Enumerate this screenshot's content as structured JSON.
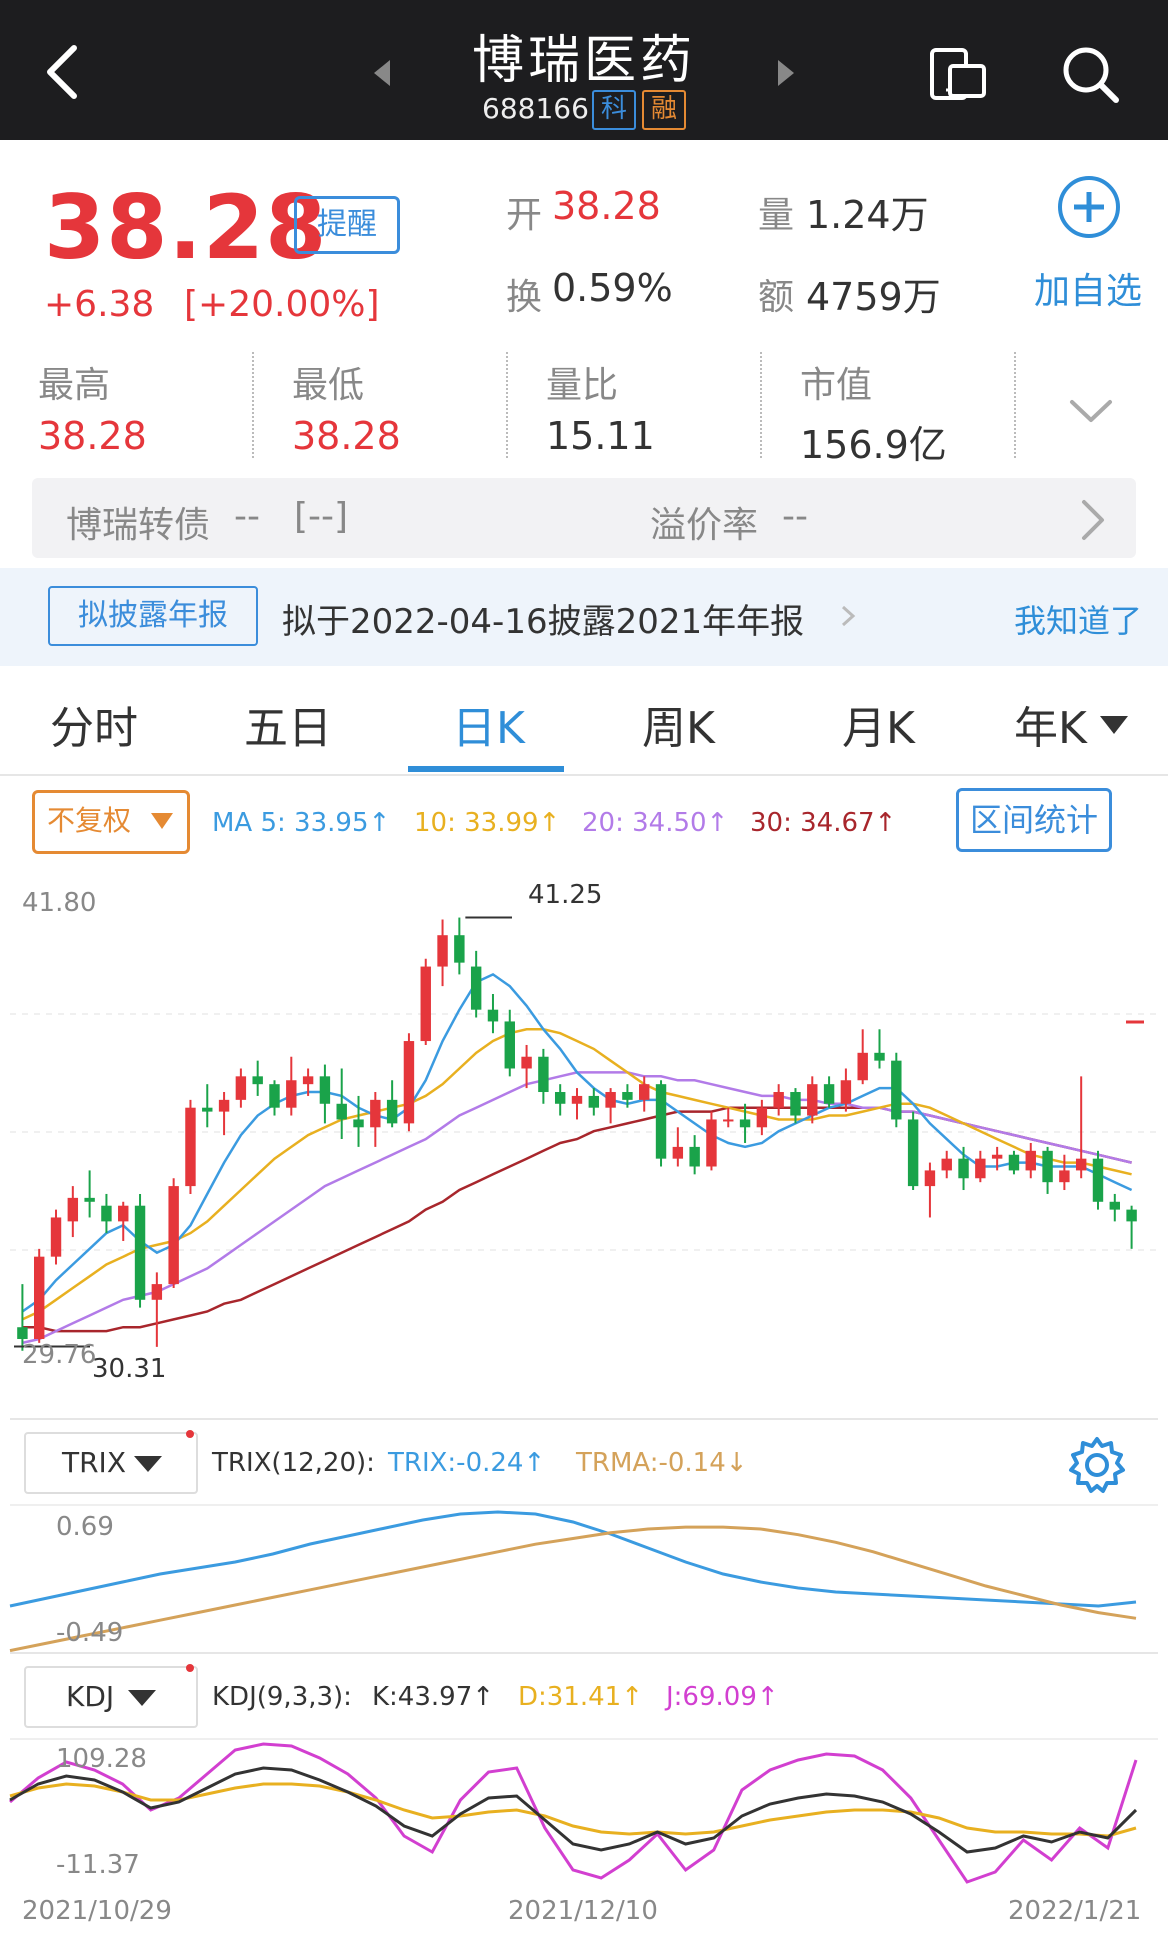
{
  "header": {
    "title": "博瑞医药",
    "code": "688166",
    "badge_ke": "科",
    "badge_rong": "融"
  },
  "quote": {
    "price": "38.28",
    "change": "+6.38",
    "change_pct": "[+20.00%]",
    "remind": "提醒",
    "open_label": "开",
    "open": "38.28",
    "volume_label": "量",
    "volume": "1.24万",
    "turnover_label": "换",
    "turnover": "0.59%",
    "amount_label": "额",
    "amount": "4759万",
    "add_watch": "加自选",
    "high_label": "最高",
    "high": "38.28",
    "low_label": "最低",
    "low": "38.28",
    "ratio_label": "量比",
    "ratio": "15.11",
    "mcap_label": "市值",
    "mcap": "156.9亿"
  },
  "bond": {
    "name": "博瑞转债",
    "value": "--",
    "pct": "[--]",
    "premium_label": "溢价率",
    "premium": "--"
  },
  "notice": {
    "tag": "拟披露年报",
    "text": "拟于2022-04-16披露2021年年报",
    "dismiss": "我知道了"
  },
  "tabs": [
    "分时",
    "五日",
    "日K",
    "周K",
    "月K",
    "年K"
  ],
  "active_tab": 2,
  "ma": {
    "adjust": "不复权",
    "ma5": "MA 5: 33.95↑",
    "ma10": "10: 33.99↑",
    "ma20": "20: 34.50↑",
    "ma30": "30: 34.67↑",
    "range_stat": "区间统计",
    "y_top": "41.80",
    "y_bottom": "29.76",
    "peak_label": "41.25",
    "low_label": "30.31"
  },
  "trix": {
    "selector": "TRIX",
    "params": "TRIX(12,20):",
    "trix": "TRIX:-0.24↑",
    "trma": "TRMA:-0.14↓",
    "y_top": "0.69",
    "y_bottom": "-0.49"
  },
  "kdj": {
    "selector": "KDJ",
    "params": "KDJ(9,3,3):",
    "k": "K:43.97↑",
    "d": "D:31.41↑",
    "j": "J:69.09↑",
    "y_top": "109.28",
    "y_bottom": "-11.37"
  },
  "dates": [
    "2021/10/29",
    "2021/12/10",
    "2022/1/21"
  ],
  "colors": {
    "up": "#e5363b",
    "down": "#1aa34a",
    "ma5": "#3b9be0",
    "ma10": "#e8b020",
    "ma20": "#b27be8",
    "ma30": "#a8262c",
    "accent": "#2f8ed8"
  },
  "chart_data": {
    "type": "candlestick",
    "ylim": [
      29.76,
      41.8
    ],
    "candles": [
      [
        30.8,
        31.9,
        30.2,
        30.5
      ],
      [
        30.5,
        32.8,
        30.4,
        32.6
      ],
      [
        32.6,
        33.8,
        32.4,
        33.6
      ],
      [
        33.5,
        34.4,
        33.1,
        34.1
      ],
      [
        34.1,
        34.8,
        33.6,
        34.0
      ],
      [
        33.9,
        34.2,
        33.2,
        33.5
      ],
      [
        33.5,
        34.0,
        33.0,
        33.9
      ],
      [
        33.9,
        34.2,
        31.3,
        31.5
      ],
      [
        31.5,
        32.2,
        30.3,
        31.9
      ],
      [
        31.9,
        34.6,
        31.8,
        34.4
      ],
      [
        34.4,
        36.6,
        34.2,
        36.4
      ],
      [
        36.4,
        37.0,
        35.9,
        36.3
      ],
      [
        36.3,
        36.8,
        35.7,
        36.6
      ],
      [
        36.6,
        37.4,
        36.4,
        37.2
      ],
      [
        37.2,
        37.6,
        36.7,
        37.0
      ],
      [
        37.0,
        37.1,
        36.2,
        36.4
      ],
      [
        36.4,
        37.7,
        36.2,
        37.1
      ],
      [
        37.0,
        37.4,
        36.7,
        37.2
      ],
      [
        37.2,
        37.5,
        36.0,
        36.5
      ],
      [
        36.5,
        37.4,
        35.6,
        36.1
      ],
      [
        36.1,
        36.7,
        35.4,
        35.9
      ],
      [
        35.9,
        36.8,
        35.4,
        36.6
      ],
      [
        36.6,
        37.1,
        35.9,
        36.0
      ],
      [
        36.0,
        38.3,
        35.8,
        38.1
      ],
      [
        38.1,
        40.2,
        38.0,
        40.0
      ],
      [
        40.0,
        41.2,
        39.5,
        40.8
      ],
      [
        40.8,
        41.25,
        39.8,
        40.1
      ],
      [
        40.0,
        40.4,
        38.7,
        38.9
      ],
      [
        38.9,
        39.3,
        38.3,
        38.6
      ],
      [
        38.6,
        38.9,
        37.2,
        37.4
      ],
      [
        37.4,
        38.0,
        36.9,
        37.7
      ],
      [
        37.7,
        37.9,
        36.5,
        36.8
      ],
      [
        36.8,
        37.0,
        36.2,
        36.5
      ],
      [
        36.5,
        36.9,
        36.1,
        36.7
      ],
      [
        36.7,
        36.9,
        36.2,
        36.4
      ],
      [
        36.4,
        36.9,
        36.0,
        36.8
      ],
      [
        36.8,
        37.0,
        36.4,
        36.6
      ],
      [
        36.6,
        37.2,
        36.3,
        37.0
      ],
      [
        37.0,
        37.1,
        34.9,
        35.1
      ],
      [
        35.1,
        35.9,
        34.9,
        35.4
      ],
      [
        35.4,
        35.7,
        34.7,
        34.9
      ],
      [
        34.9,
        36.3,
        34.8,
        36.1
      ],
      [
        36.1,
        36.4,
        35.9,
        36.1
      ],
      [
        36.1,
        36.5,
        35.5,
        35.9
      ],
      [
        35.9,
        36.6,
        35.7,
        36.4
      ],
      [
        36.4,
        37.0,
        36.2,
        36.8
      ],
      [
        36.8,
        36.9,
        36.0,
        36.2
      ],
      [
        36.2,
        37.2,
        36.0,
        37.0
      ],
      [
        37.0,
        37.2,
        36.4,
        36.5
      ],
      [
        36.5,
        37.4,
        36.3,
        37.1
      ],
      [
        37.1,
        38.4,
        37.0,
        37.8
      ],
      [
        37.8,
        38.4,
        37.4,
        37.6
      ],
      [
        37.6,
        37.8,
        35.9,
        36.1
      ],
      [
        36.1,
        36.3,
        34.3,
        34.4
      ],
      [
        34.4,
        35.0,
        33.6,
        34.8
      ],
      [
        34.8,
        35.3,
        34.6,
        35.1
      ],
      [
        35.1,
        35.4,
        34.3,
        34.6
      ],
      [
        34.6,
        35.3,
        34.5,
        35.1
      ],
      [
        35.1,
        35.4,
        34.8,
        35.2
      ],
      [
        35.2,
        35.3,
        34.7,
        34.8
      ],
      [
        34.8,
        35.5,
        34.6,
        35.3
      ],
      [
        35.3,
        35.4,
        34.2,
        34.5
      ],
      [
        34.5,
        35.2,
        34.3,
        34.8
      ],
      [
        34.8,
        37.2,
        34.6,
        35.1
      ],
      [
        35.1,
        35.3,
        33.8,
        34.0
      ],
      [
        34.0,
        34.2,
        33.5,
        33.8
      ],
      [
        33.8,
        33.9,
        32.8,
        33.5
      ]
    ],
    "ma5": [
      31.2,
      31.5,
      32.0,
      32.4,
      32.8,
      33.2,
      33.4,
      33.0,
      32.7,
      32.9,
      33.4,
      34.2,
      35.0,
      35.7,
      36.2,
      36.5,
      36.7,
      36.8,
      36.8,
      36.7,
      36.4,
      36.2,
      36.1,
      36.4,
      37.1,
      38.1,
      38.9,
      39.6,
      39.8,
      39.5,
      39.0,
      38.4,
      37.9,
      37.3,
      36.9,
      36.6,
      36.5,
      36.6,
      36.6,
      36.3,
      36.0,
      35.7,
      35.5,
      35.4,
      35.5,
      35.8,
      36.0,
      36.2,
      36.4,
      36.5,
      36.7,
      36.9,
      36.9,
      36.5,
      36.0,
      35.6,
      35.2,
      34.9,
      34.9,
      35.0,
      35.0,
      34.9,
      34.9,
      34.9,
      34.7,
      34.5,
      34.3
    ],
    "ma10": [
      31.0,
      31.2,
      31.5,
      31.8,
      32.1,
      32.4,
      32.6,
      32.8,
      32.9,
      33.0,
      33.2,
      33.5,
      33.9,
      34.3,
      34.7,
      35.1,
      35.4,
      35.7,
      35.9,
      36.1,
      36.2,
      36.3,
      36.4,
      36.5,
      36.7,
      37.0,
      37.4,
      37.8,
      38.1,
      38.3,
      38.4,
      38.4,
      38.3,
      38.1,
      37.9,
      37.6,
      37.3,
      37.0,
      36.8,
      36.7,
      36.6,
      36.5,
      36.4,
      36.3,
      36.2,
      36.1,
      36.1,
      36.1,
      36.2,
      36.2,
      36.3,
      36.4,
      36.5,
      36.5,
      36.4,
      36.2,
      36.0,
      35.8,
      35.6,
      35.4,
      35.2,
      35.1,
      35.0,
      35.0,
      34.9,
      34.8,
      34.7
    ],
    "ma20": [
      30.4,
      30.5,
      30.7,
      30.9,
      31.1,
      31.3,
      31.5,
      31.6,
      31.7,
      31.9,
      32.1,
      32.3,
      32.6,
      32.9,
      33.2,
      33.5,
      33.8,
      34.1,
      34.4,
      34.6,
      34.8,
      35.0,
      35.2,
      35.4,
      35.6,
      35.9,
      36.2,
      36.4,
      36.6,
      36.8,
      37.0,
      37.1,
      37.2,
      37.3,
      37.3,
      37.3,
      37.3,
      37.2,
      37.2,
      37.1,
      37.1,
      37.0,
      36.9,
      36.8,
      36.7,
      36.7,
      36.6,
      36.6,
      36.5,
      36.5,
      36.4,
      36.4,
      36.3,
      36.3,
      36.2,
      36.1,
      36.0,
      35.9,
      35.8,
      35.7,
      35.6,
      35.5,
      35.4,
      35.3,
      35.2,
      35.1,
      35.0
    ],
    "ma30": [
      30.8,
      30.8,
      30.7,
      30.7,
      30.7,
      30.7,
      30.8,
      30.8,
      30.9,
      31.0,
      31.1,
      31.2,
      31.4,
      31.5,
      31.7,
      31.9,
      32.1,
      32.3,
      32.5,
      32.7,
      32.9,
      33.1,
      33.3,
      33.5,
      33.8,
      34.0,
      34.3,
      34.5,
      34.7,
      34.9,
      35.1,
      35.3,
      35.5,
      35.6,
      35.8,
      35.9,
      36.0,
      36.1,
      36.2,
      36.3,
      36.3,
      36.3,
      36.4,
      36.4,
      36.4,
      36.4,
      36.4,
      36.4,
      36.4,
      36.4,
      36.4,
      36.4,
      36.3,
      36.3,
      36.2,
      36.1,
      36.0,
      35.9,
      35.8,
      35.7,
      35.6,
      35.5,
      35.4,
      35.3,
      35.2,
      35.1,
      35.0
    ]
  }
}
